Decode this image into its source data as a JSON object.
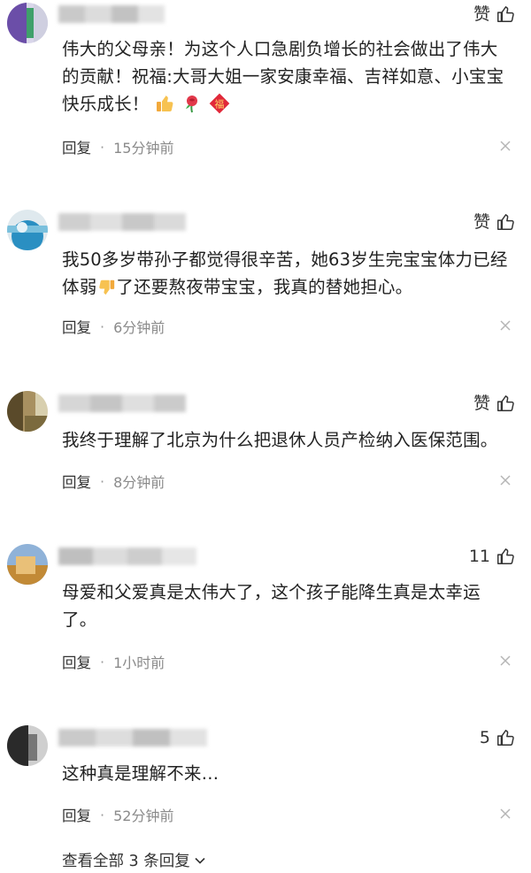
{
  "comments": [
    {
      "like_label": "赞",
      "text_parts": [
        "伟大的父母亲！为这个人口急剧负增长的社会做出了伟大的贡献！祝福:大哥大姐一家安康幸福、吉祥如意、小宝宝快乐成长！"
      ],
      "emoji_names": [
        "thumbs-up-emoji",
        "rose-emoji",
        "fu-emoji"
      ],
      "emoji_fu": "福",
      "reply": "回复",
      "time": "15分钟前",
      "avatar_colors": [
        "#6b4ea8",
        "#3fa06a",
        "#d8d8e8"
      ]
    },
    {
      "like_label": "赞",
      "text_before": "我50多岁带孙子都觉得很辛苦，她63岁生完宝宝体力已经体弱",
      "text_after": "了还要熬夜带宝宝，我真的替她担心。",
      "emoji_names": [
        "thumbs-down-emoji"
      ],
      "reply": "回复",
      "time": "6分钟前",
      "avatar_colors": [
        "#2a8fc2",
        "#7ac0dd",
        "#e4edf2"
      ]
    },
    {
      "like_label": "赞",
      "text": "我终于理解了北京为什么把退休人员产检纳入医保范围。",
      "reply": "回复",
      "time": "8分钟前",
      "avatar_colors": [
        "#5a4a2a",
        "#a89060",
        "#d8cfae"
      ]
    },
    {
      "like_label": "11",
      "text": "母爱和父爱真是太伟大了，这个孩子能降生真是太幸运了。",
      "reply": "回复",
      "time": "1小时前",
      "avatar_colors": [
        "#c28a36",
        "#e9c078",
        "#8fb2d8"
      ]
    },
    {
      "like_label": "5",
      "text": "这种真是理解不来…",
      "reply": "回复",
      "time": "52分钟前",
      "avatar_colors": [
        "#2a2a2a",
        "#777777",
        "#cfcfcf"
      ]
    }
  ],
  "view_all_label": "查看全部 3 条回复"
}
